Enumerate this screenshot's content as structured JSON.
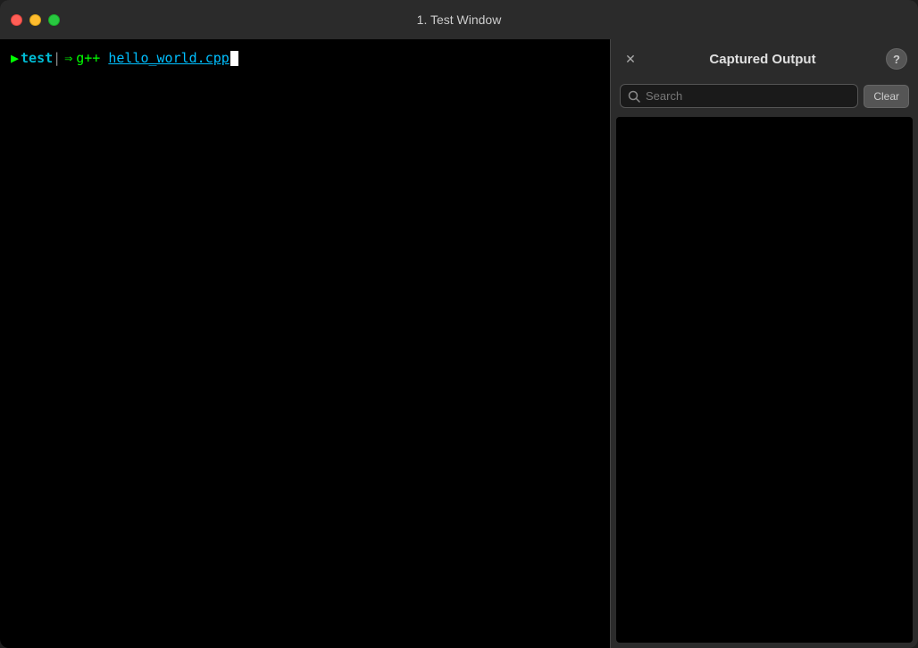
{
  "window": {
    "title": "1. Test Window"
  },
  "traffic_lights": {
    "close_label": "close",
    "minimize_label": "minimize",
    "maximize_label": "maximize"
  },
  "terminal": {
    "prompt_arrow": "▶",
    "prompt_dir": "test",
    "separator": "|",
    "arrow_symbol": "⇒",
    "command": "g++",
    "filename": "hello_world.cpp"
  },
  "captured_panel": {
    "title": "Captured Output",
    "close_label": "✕",
    "help_label": "?",
    "search_placeholder": "Search",
    "clear_label": "Clear"
  }
}
